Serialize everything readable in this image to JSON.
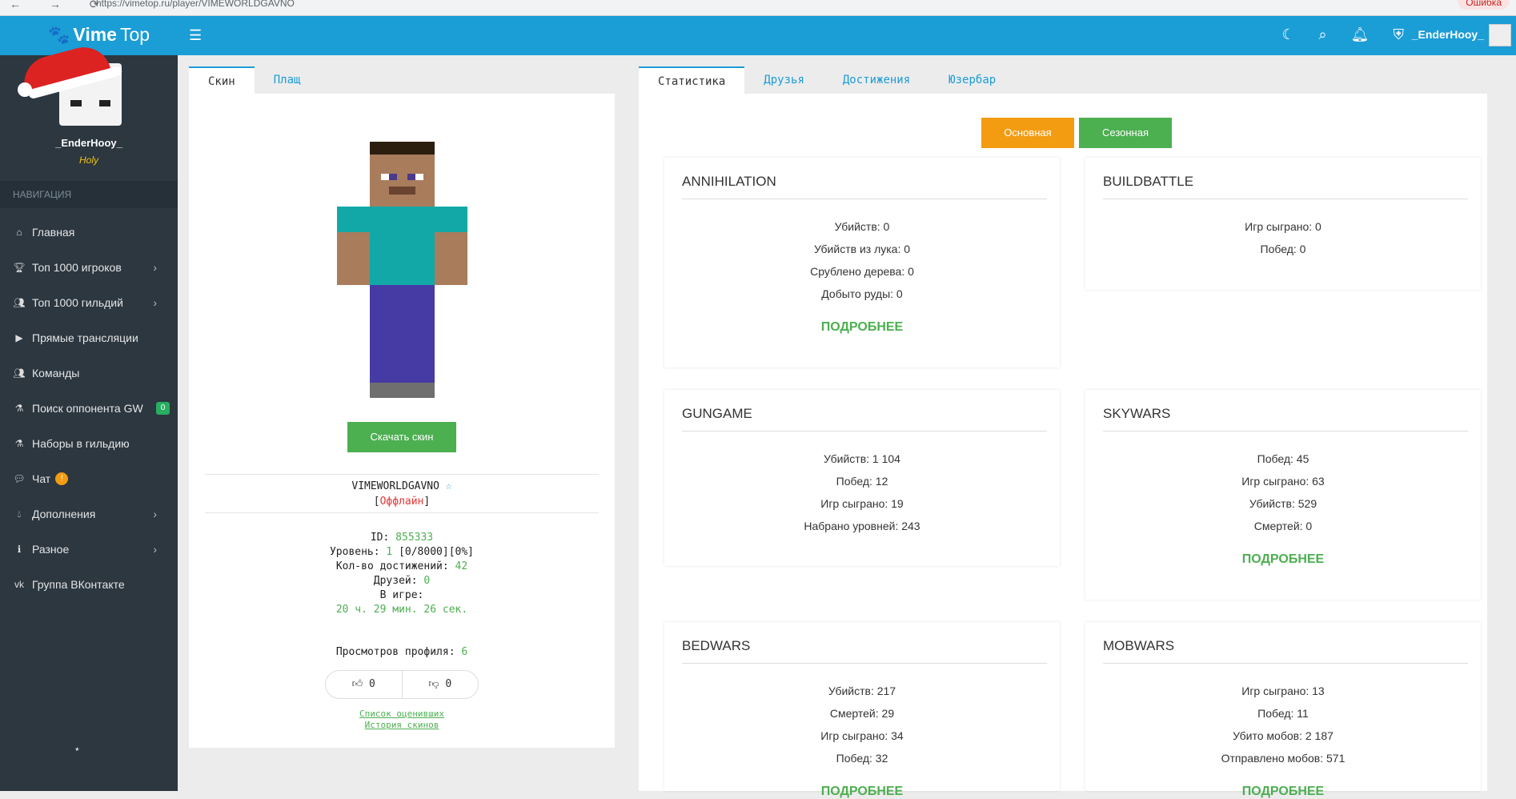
{
  "browser": {
    "url": "https://vimetop.ru/player/VIMEWORLDGAVNO",
    "error_label": "Ошибка"
  },
  "topbar": {
    "logo_vime": "Vime",
    "logo_top": "Top",
    "username": "_EnderHooy_"
  },
  "sidebar": {
    "name": "_EnderHooy_",
    "rank": "Holy",
    "nav_header": "НАВИГАЦИЯ",
    "items": [
      {
        "label": "Главная"
      },
      {
        "label": "Топ 1000 игроков"
      },
      {
        "label": "Топ 1000 гильдий"
      },
      {
        "label": "Прямые трансляции"
      },
      {
        "label": "Команды"
      },
      {
        "label": "Поиск оппонента GW",
        "badge": "0"
      },
      {
        "label": "Наборы в гильдию"
      },
      {
        "label": "Чат",
        "badge": "!"
      },
      {
        "label": "Дополнения"
      },
      {
        "label": "Разное"
      },
      {
        "label": "Группа ВКонтакте"
      }
    ],
    "footer_star": "*"
  },
  "skin_tabs": [
    "Скин",
    "Плащ"
  ],
  "skin": {
    "download_label": "Скачать скин",
    "nickname": "VIMEWORLDGAVNO",
    "star": "☆",
    "status_open": "[",
    "status": "Оффлайн",
    "status_close": "]",
    "id_label": "ID:",
    "id_value": "855333",
    "level_label": "Уровень:",
    "level_value": "1",
    "level_exp": "[0/8000]",
    "level_percent": "[0%]",
    "achievements_label": "Кол-во достижений:",
    "achievements_value": "42",
    "friends_label": "Друзей:",
    "friends_value": "0",
    "ingame_label": "В игре:",
    "ingame_value": "20 ч. 29 мин. 26 сек.",
    "views_label": "Просмотров профиля:",
    "views_value": "6",
    "likes": "0",
    "dislikes": "0",
    "link_raters": "Список оценивших",
    "link_skin_history": "История скинов"
  },
  "stats_tabs": [
    "Статистика",
    "Друзья",
    "Достижения",
    "Юзербар"
  ],
  "modes": {
    "main": "Основная",
    "season": "Сезонная"
  },
  "more_label": "ПОДРОБНЕЕ",
  "games": [
    {
      "title": "ANNIHILATION",
      "stats": [
        "Убийств: 0",
        "Убийств из лука: 0",
        "Срублено дерева: 0",
        "Добыто руды: 0"
      ]
    },
    {
      "title": "BUILDBATTLE",
      "stats": [
        "Игр сыграно: 0",
        "Побед: 0"
      ]
    },
    {
      "title": "GUNGAME",
      "stats": [
        "Убийств: 1 104",
        "Побед: 12",
        "Игр сыграно: 19",
        "Набрано уровней: 243"
      ]
    },
    {
      "title": "SKYWARS",
      "stats": [
        "Побед: 45",
        "Игр сыграно: 63",
        "Убийств: 529",
        "Смертей: 0"
      ]
    },
    {
      "title": "BEDWARS",
      "stats": [
        "Убийств: 217",
        "Смертей: 29",
        "Игр сыграно: 34",
        "Побед: 32"
      ]
    },
    {
      "title": "MOBWARS",
      "stats": [
        "Игр сыграно: 13",
        "Побед: 11",
        "Убито мобов: 2 187",
        "Отправлено мобов: 571"
      ]
    }
  ],
  "colors": {
    "topbar": "#1b9dd6",
    "sidebar": "#2c3740",
    "accent_green": "#4caf50",
    "accent_orange": "#f39c12"
  }
}
